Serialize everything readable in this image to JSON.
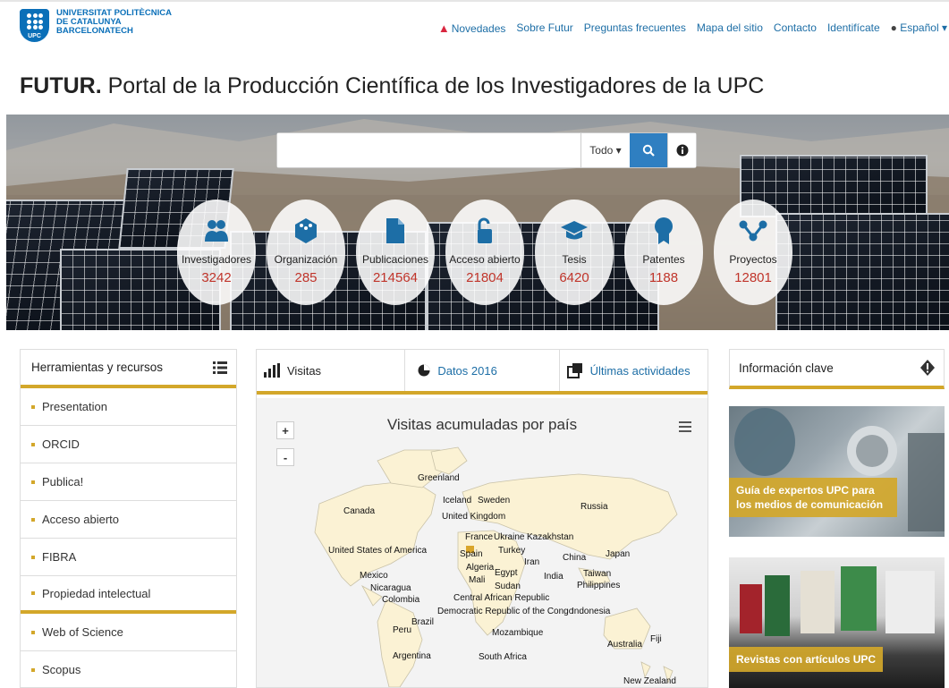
{
  "header": {
    "logo_lines": [
      "UNIVERSITAT POLITÈCNICA",
      "DE CATALUNYA",
      "BARCELONATECH"
    ],
    "logo_badge": "UPC",
    "nav": [
      {
        "label": "Novedades",
        "icon": "warning-icon"
      },
      {
        "label": "Sobre Futur"
      },
      {
        "label": "Preguntas frecuentes"
      },
      {
        "label": "Mapa del sitio"
      },
      {
        "label": "Contacto"
      },
      {
        "label": "Identifícate"
      },
      {
        "label": "Español",
        "icon": "globe-icon"
      }
    ]
  },
  "title": {
    "bold": "FUTUR.",
    "rest": " Portal de la Producción Científica de los Investigadores de la UPC"
  },
  "search": {
    "value": "",
    "scope": "Todo"
  },
  "stats": [
    {
      "label": "Investigadores",
      "value": "3242",
      "icon": "researchers-icon"
    },
    {
      "label": "Organización",
      "value": "285",
      "icon": "organization-icon"
    },
    {
      "label": "Publicaciones",
      "value": "214564",
      "icon": "document-icon"
    },
    {
      "label": "Acceso abierto",
      "value": "21804",
      "icon": "open-lock-icon"
    },
    {
      "label": "Tesis",
      "value": "6420",
      "icon": "graduation-cap-icon"
    },
    {
      "label": "Patentes",
      "value": "1188",
      "icon": "award-ribbon-icon"
    },
    {
      "label": "Proyectos",
      "value": "12801",
      "icon": "network-icon"
    }
  ],
  "tools": {
    "title": "Herramientas y recursos",
    "items": [
      "Presentation",
      "ORCID",
      "Publica!",
      "Acceso abierto",
      "FIBRA",
      "Propiedad intelectual",
      "Web of Science",
      "Scopus"
    ]
  },
  "tabs": [
    {
      "label": "Visitas",
      "icon": "bar-chart-icon"
    },
    {
      "label": "Datos 2016",
      "icon": "pie-chart-icon"
    },
    {
      "label": "Últimas actividades",
      "icon": "activity-icon"
    }
  ],
  "map": {
    "title": "Visitas acumuladas por país",
    "zoom_in": "+",
    "zoom_out": "-",
    "countries": [
      "Greenland",
      "Iceland",
      "Sweden",
      "Canada",
      "United Kingdom",
      "Russia",
      "France",
      "Ukraine",
      "Kazakhstan",
      "United States of America",
      "Spain",
      "Turkey",
      "Japan",
      "Iran",
      "China",
      "Algeria",
      "Egypt",
      "Mexico",
      "India",
      "Taiwan",
      "Mali",
      "Sudan",
      "Nicaragua",
      "Philippines",
      "Colombia",
      "Central African Republic",
      "Democratic Republic of the Congo",
      "Indonesia",
      "Brazil",
      "Peru",
      "Mozambique",
      "Fiji",
      "Australia",
      "Argentina",
      "South Africa",
      "New Zealand"
    ]
  },
  "info": {
    "title": "Información clave",
    "cards": [
      {
        "label": "Guía de expertos UPC para los medios de comunicación"
      },
      {
        "label": "Revistas con artículos UPC"
      }
    ]
  }
}
